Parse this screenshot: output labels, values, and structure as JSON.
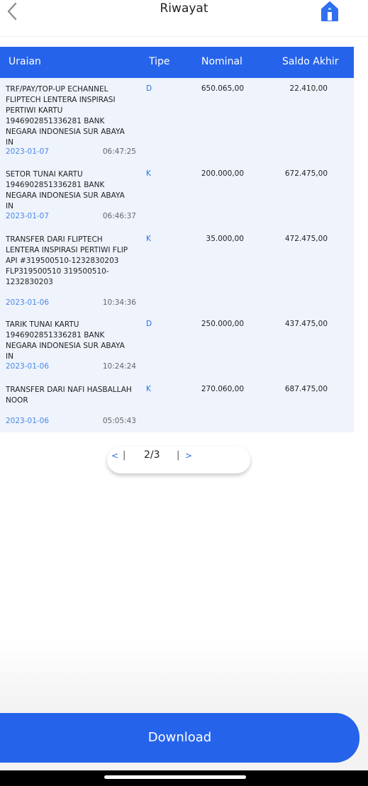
{
  "header": {
    "title": "Riwayat"
  },
  "table": {
    "columns": [
      "Uraian",
      "Tipe",
      "Nominal",
      "Saldo Akhir"
    ],
    "rows": [
      {
        "description": "TRF/PAY/TOP-UP ECHANNEL FLIPTECH LENTERA INSPIRASI PERTIWI KARTU 1946902851336281 BANK NEGARA INDONESIA SUR ABAYA IN",
        "type": "D",
        "nominal": "650.065,00",
        "balance": "22.410,00",
        "date": "2023-01-07",
        "time": "06:47:25"
      },
      {
        "description": "SETOR TUNAI KARTU 1946902851336281 BANK NEGARA INDONESIA SUR ABAYA IN",
        "type": "K",
        "nominal": "200.000,00",
        "balance": "672.475,00",
        "date": "2023-01-07",
        "time": "06:46:37"
      },
      {
        "description": "TRANSFER DARI FLIPTECH LENTERA INSPIRASI PERTIWI FLIP API #319500510-1232830203 FLP319500510 319500510-1232830203",
        "type": "K",
        "nominal": "35.000,00",
        "balance": "472.475,00",
        "date": "2023-01-06",
        "time": "10:34:36"
      },
      {
        "description": "TARIK TUNAI KARTU 1946902851336281 BANK NEGARA INDONESIA SUR ABAYA IN",
        "type": "D",
        "nominal": "250.000,00",
        "balance": "437.475,00",
        "date": "2023-01-06",
        "time": "10:24:24"
      },
      {
        "description": "TRANSFER DARI NAFI HASBALLAH NOOR",
        "type": "K",
        "nominal": "270.060,00",
        "balance": "687.475,00",
        "date": "2023-01-06",
        "time": "05:05:43"
      }
    ]
  },
  "pagination": {
    "prev": "<",
    "sep": "|",
    "page": "2/3",
    "next": ">"
  },
  "footer": {
    "download_label": "Download"
  },
  "colors": {
    "accent": "#2563eb",
    "row_bg": "#eef3fc",
    "date": "#4a88e8",
    "type": "#2b6fe6"
  },
  "icons": {
    "back": "chevron-left-icon",
    "home": "home-icon"
  }
}
